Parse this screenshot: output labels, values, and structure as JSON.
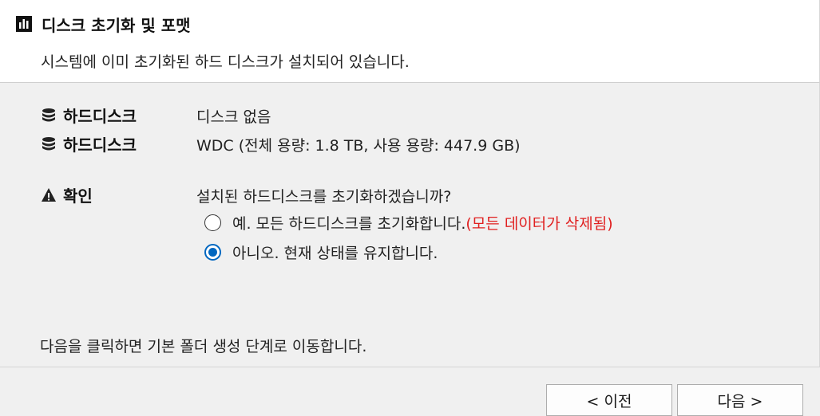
{
  "window": {
    "title": "디스크 초기화 및 포맷",
    "subtitle": "시스템에 이미 초기화된 하드 디스크가 설치되어 있습니다."
  },
  "disks": [
    {
      "label": "하드디스크",
      "icon": "database-icon",
      "value": "디스크 없음"
    },
    {
      "label": "하드디스크",
      "icon": "database-icon",
      "value": "WDC (전체 용량: 1.8 TB, 사용 용량: 447.9 GB)"
    }
  ],
  "confirm": {
    "label": "확인",
    "icon": "warning-icon",
    "question": "설치된 하드디스크를 초기화하겠습니까?",
    "options": [
      {
        "text": "예. 모든 하드디스크를 초기화합니다.",
        "warning": "(모든 데이터가 삭제됨)",
        "checked": false
      },
      {
        "text": "아니오. 현재 상태를 유지합니다.",
        "warning": "",
        "checked": true
      }
    ]
  },
  "footer_note": "다음을 클릭하면 기본 폴더 생성 단계로 이동합니다.",
  "buttons": {
    "prev": "< 이전",
    "next": "다음 >"
  },
  "colors": {
    "accent": "#0067c0",
    "warning": "#e02020"
  }
}
